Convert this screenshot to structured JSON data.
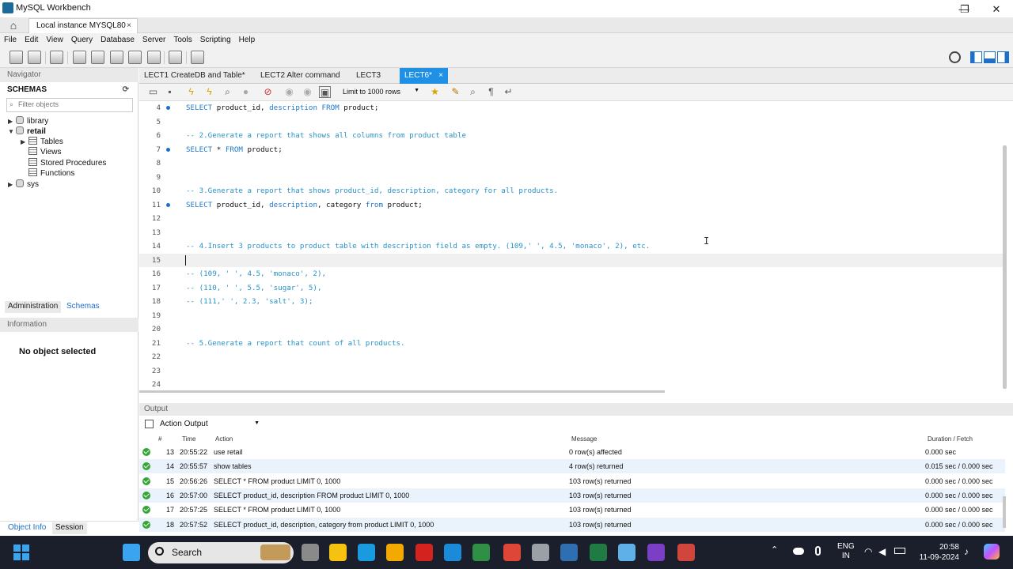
{
  "window": {
    "title": "MySQL Workbench",
    "minimize": "—",
    "maximize": "❐",
    "close": "✕"
  },
  "connection_tab": {
    "label": "Local instance MYSQL80",
    "close": "×"
  },
  "menu": [
    "File",
    "Edit",
    "View",
    "Query",
    "Database",
    "Server",
    "Tools",
    "Scripting",
    "Help"
  ],
  "navigator": {
    "title": "Navigator",
    "schemas_label": "SCHEMAS",
    "filter_placeholder": "Filter objects",
    "tree": [
      {
        "arrow": "▶",
        "label": "library"
      },
      {
        "arrow": "▼",
        "label": "retail"
      },
      {
        "arrow": "▶",
        "label": "Tables"
      },
      {
        "arrow": "",
        "label": "Views"
      },
      {
        "arrow": "",
        "label": "Stored Procedures"
      },
      {
        "arrow": "",
        "label": "Functions"
      },
      {
        "arrow": "▶",
        "label": "sys"
      }
    ],
    "tabs": [
      "Administration",
      "Schemas"
    ],
    "information_title": "Information",
    "no_object": "No object selected",
    "bottom_tabs": [
      "Object Info",
      "Session"
    ]
  },
  "editor_tabs": [
    {
      "label": "LECT1 CreateDB and Table*"
    },
    {
      "label": "LECT2 Alter command"
    },
    {
      "label": "LECT3"
    },
    {
      "label": "LECT6*",
      "close": "×",
      "active": true
    }
  ],
  "limit_select": "Limit to 1000 rows",
  "code_lines": [
    {
      "n": "4",
      "dot": true,
      "text": "SELECT product_id, description FROM product;"
    },
    {
      "n": "5",
      "text": ""
    },
    {
      "n": "6",
      "text": "-- 2.Generate a report that shows all columns from product table"
    },
    {
      "n": "7",
      "dot": true,
      "text": "SELECT * FROM product;"
    },
    {
      "n": "8",
      "text": ""
    },
    {
      "n": "9",
      "text": ""
    },
    {
      "n": "10",
      "text": "-- 3.Generate a report that shows product_id, description, category for all products."
    },
    {
      "n": "11",
      "dot": true,
      "text": "SELECT product_id, description, category from product;"
    },
    {
      "n": "12",
      "text": ""
    },
    {
      "n": "13",
      "text": ""
    },
    {
      "n": "14",
      "text": "-- 4.Insert 3 products to product table with description field as empty. (109,' ', 4.5, 'monaco', 2), etc."
    },
    {
      "n": "15",
      "text": ""
    },
    {
      "n": "16",
      "text": "-- (109, ' ', 4.5, 'monaco', 2),"
    },
    {
      "n": "17",
      "text": "-- (110, ' ', 5.5, 'sugar', 5),"
    },
    {
      "n": "18",
      "text": "-- (111,' ', 2.3, 'salt', 3);"
    },
    {
      "n": "19",
      "text": ""
    },
    {
      "n": "20",
      "text": ""
    },
    {
      "n": "21",
      "text": "-- 5.Generate a report that count of all products."
    },
    {
      "n": "22",
      "text": ""
    },
    {
      "n": "23",
      "text": ""
    },
    {
      "n": "24",
      "text": ""
    }
  ],
  "output": {
    "title": "Output",
    "mode": "Action Output",
    "columns": [
      "#",
      "Time",
      "Action",
      "Message",
      "Duration / Fetch"
    ],
    "rows": [
      {
        "n": "13",
        "time": "20:55:22",
        "action": "use retail",
        "message": "0 row(s) affected",
        "duration": "0.000 sec"
      },
      {
        "n": "14",
        "time": "20:55:57",
        "action": "show tables",
        "message": "4 row(s) returned",
        "duration": "0.015 sec / 0.000 sec"
      },
      {
        "n": "15",
        "time": "20:56:26",
        "action": "SELECT * FROM product LIMIT 0, 1000",
        "message": "103 row(s) returned",
        "duration": "0.000 sec / 0.000 sec"
      },
      {
        "n": "16",
        "time": "20:57:00",
        "action": "SELECT product_id, description FROM product LIMIT 0, 1000",
        "message": "103 row(s) returned",
        "duration": "0.000 sec / 0.000 sec"
      },
      {
        "n": "17",
        "time": "20:57:25",
        "action": "SELECT * FROM product LIMIT 0, 1000",
        "message": "103 row(s) returned",
        "duration": "0.000 sec / 0.000 sec"
      },
      {
        "n": "18",
        "time": "20:57:52",
        "action": "SELECT product_id, description, category from product LIMIT 0, 1000",
        "message": "103 row(s) returned",
        "duration": "0.000 sec / 0.000 sec"
      }
    ]
  },
  "taskbar": {
    "search": "Search",
    "lang": "ENG",
    "region": "IN",
    "time": "20:58",
    "date": "11-09-2024",
    "app_colors": [
      "#8a8a8a",
      "#f5c211",
      "#1a9be0",
      "#f2a900",
      "#d4231f",
      "#1b8ad8",
      "#2f8f44",
      "#de4637",
      "#9aa0a6",
      "#2f6fb1",
      "#1f7a43",
      "#5fb0e8",
      "#7a3fc5",
      "#d0453c"
    ]
  },
  "colors": {
    "accent": "#1e90e5",
    "keyword": "#1e78c8",
    "comment": "#2a92c8",
    "ok": "#35a636"
  }
}
